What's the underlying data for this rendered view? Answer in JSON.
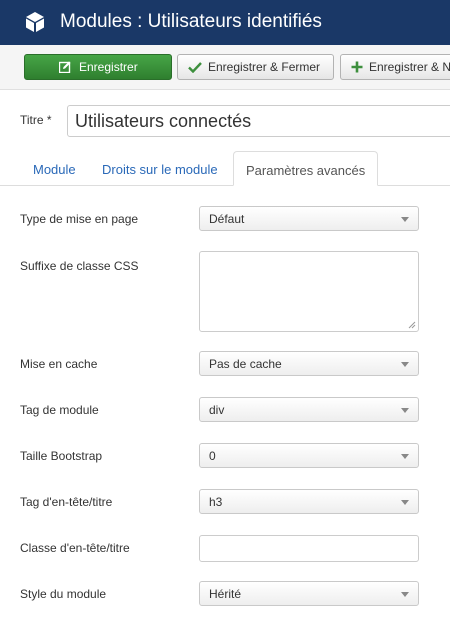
{
  "header": {
    "title": "Modules : Utilisateurs identifiés",
    "icon": "cube-icon"
  },
  "toolbar": {
    "save_label": "Enregistrer",
    "save_close_label": "Enregistrer & Fermer",
    "save_new_label": "Enregistrer & N"
  },
  "form": {
    "title_label": "Titre *",
    "title_value": "Utilisateurs connectés"
  },
  "tabs": {
    "module": "Module",
    "permissions": "Droits sur le module",
    "advanced": "Paramètres avancés"
  },
  "fields": {
    "layout": {
      "label": "Type de mise en page",
      "value": "Défaut"
    },
    "css_suffix": {
      "label": "Suffixe de classe CSS",
      "value": ""
    },
    "caching": {
      "label": "Mise en cache",
      "value": "Pas de cache"
    },
    "module_tag": {
      "label": "Tag de module",
      "value": "div"
    },
    "bootstrap_size": {
      "label": "Taille Bootstrap",
      "value": "0"
    },
    "header_tag": {
      "label": "Tag d'en-tête/titre",
      "value": "h3"
    },
    "header_class": {
      "label": "Classe d'en-tête/titre",
      "value": ""
    },
    "module_style": {
      "label": "Style du module",
      "value": "Hérité"
    }
  },
  "colors": {
    "header_bg": "#1a3867",
    "save_green": "#3d8f3d",
    "tab_link": "#2a69b8"
  }
}
